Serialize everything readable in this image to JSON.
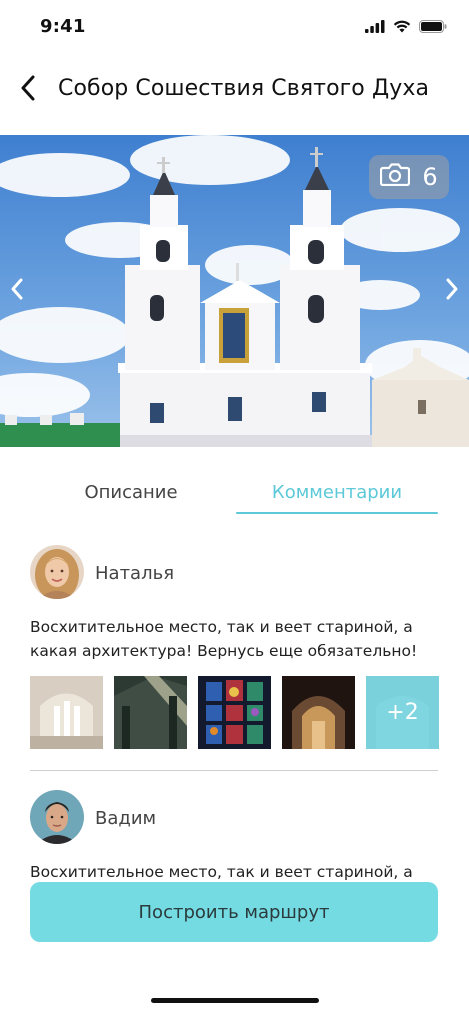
{
  "status_bar": {
    "time": "9:41"
  },
  "header": {
    "title": "Собор Сошествия Святого Духа"
  },
  "gallery": {
    "photo_count": "6"
  },
  "tabs": [
    {
      "label": "Описание",
      "active": false
    },
    {
      "label": "Комментарии",
      "active": true
    }
  ],
  "comments": [
    {
      "author": "Наталья",
      "text": "Восхитительное место, так и веет стариной, а какая архитектура! Вернусь еще обязательно!",
      "more_photos": "+2"
    },
    {
      "author": "Вадим",
      "text": "Восхитительное место, так и веет стариной, а"
    }
  ],
  "route_button": {
    "label": "Построить маршрут"
  },
  "colors": {
    "accent": "#5cc9d8",
    "button": "#74dbe3"
  }
}
